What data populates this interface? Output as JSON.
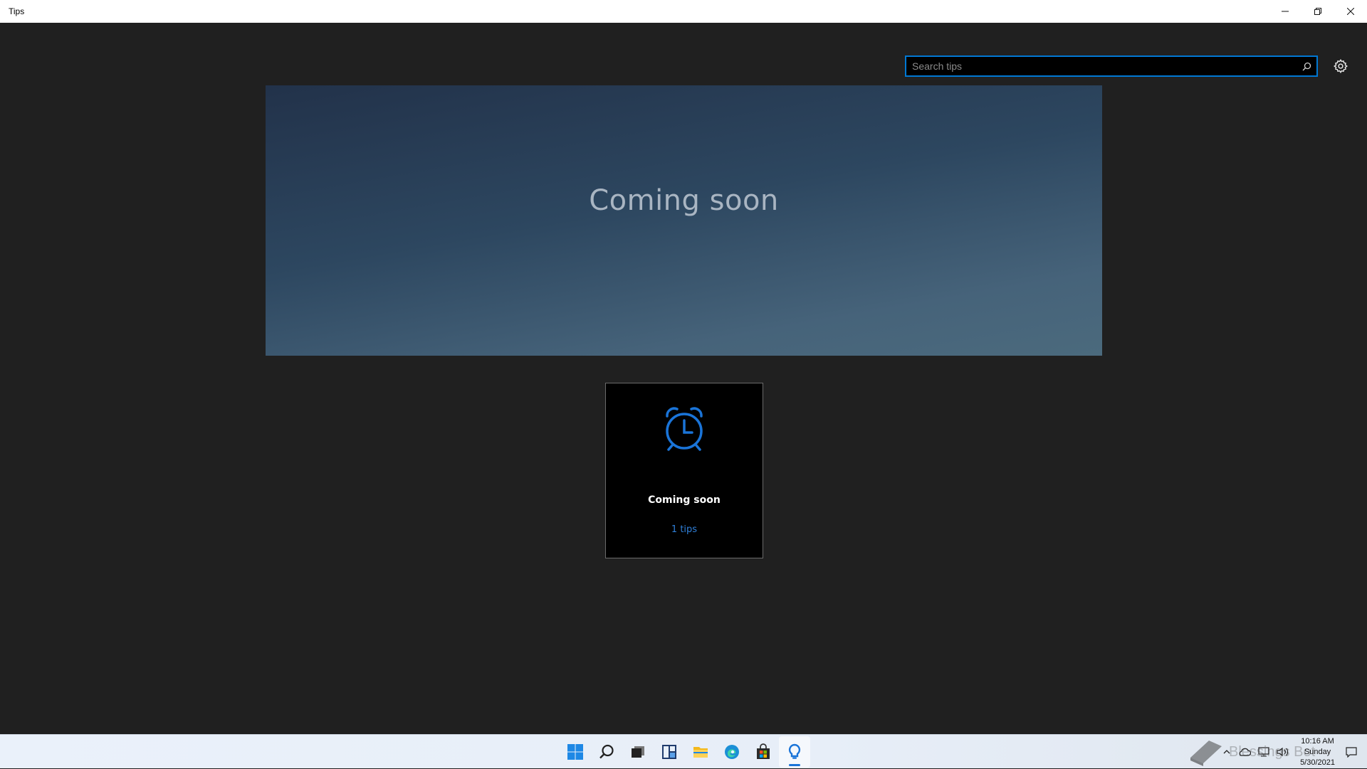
{
  "window": {
    "title": "Tips",
    "controls": {
      "minimize": "—",
      "restore": "❐",
      "close": "✕"
    }
  },
  "search": {
    "placeholder": "Search tips",
    "value": ""
  },
  "hero": {
    "title": "Coming soon"
  },
  "card": {
    "title": "Coming soon",
    "count": "1 tips",
    "icon": "alarm-clock-icon",
    "accent": "#1a74d8"
  },
  "taskbar": {
    "pinned": [
      {
        "name": "start-button",
        "icon": "windows-logo-icon"
      },
      {
        "name": "search-button",
        "icon": "search-icon"
      },
      {
        "name": "task-view-button",
        "icon": "task-view-icon"
      },
      {
        "name": "widgets-button",
        "icon": "widgets-icon"
      },
      {
        "name": "file-explorer-button",
        "icon": "folder-icon"
      },
      {
        "name": "edge-button",
        "icon": "edge-icon"
      },
      {
        "name": "store-button",
        "icon": "store-icon"
      },
      {
        "name": "tips-button",
        "icon": "tips-bulb-icon",
        "active": true
      }
    ],
    "watermark": "Blessings Bot",
    "clock": {
      "time": "10:16 AM",
      "day": "Sunday",
      "date": "5/30/2021"
    }
  }
}
